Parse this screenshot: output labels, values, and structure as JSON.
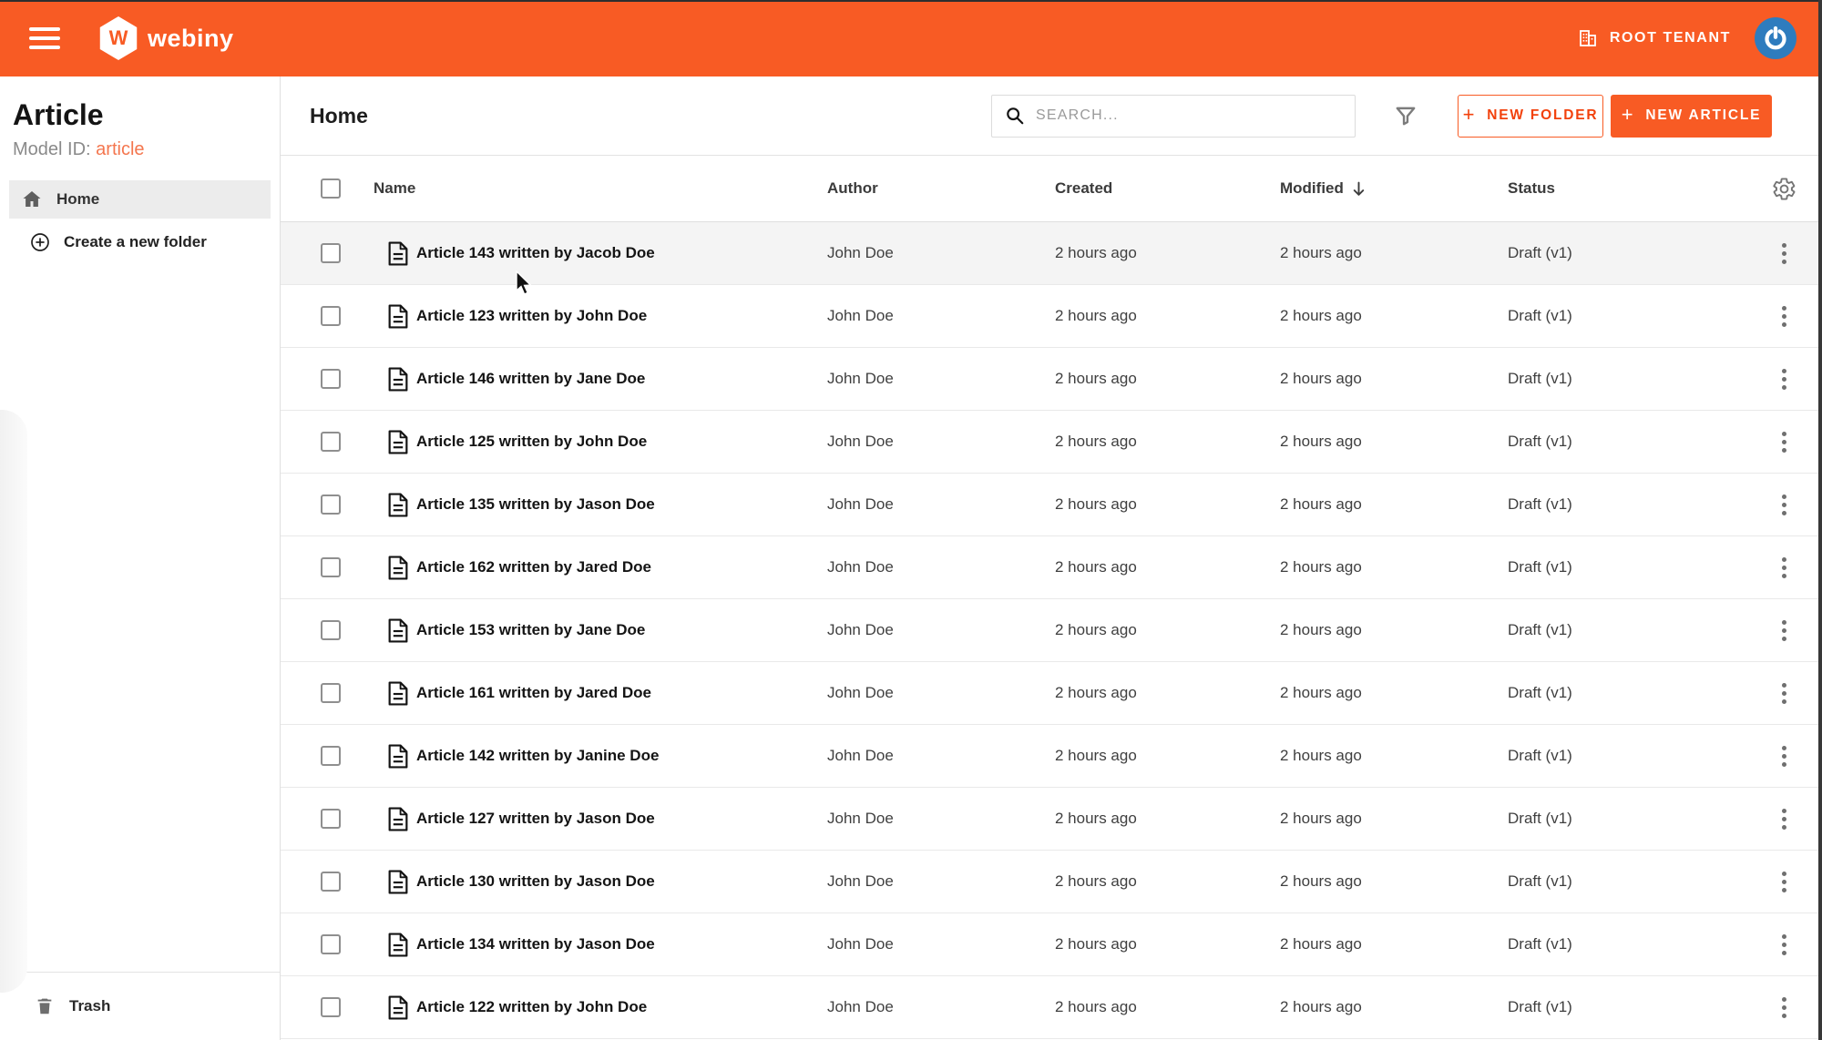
{
  "topbar": {
    "tenant_label": "ROOT TENANT"
  },
  "brand": {
    "logo_letter": "W",
    "logo_text": "webiny"
  },
  "sidebar": {
    "title": "Article",
    "model_id_label": "Model ID:",
    "model_id_value": "article",
    "home_label": "Home",
    "create_folder_label": "Create a new folder",
    "trash_label": "Trash"
  },
  "content": {
    "header": {
      "title": "Home",
      "search_placeholder": "SEARCH...",
      "plus": "+",
      "new_folder_label": "NEW FOLDER",
      "new_article_label": "NEW ARTICLE"
    },
    "table": {
      "columns": {
        "name": "Name",
        "author": "Author",
        "created": "Created",
        "modified": "Modified",
        "status": "Status"
      },
      "sorted_by": "Modified",
      "sort_direction": "desc",
      "rows": [
        {
          "name": "Article 143 written by Jacob Doe",
          "author": "John Doe",
          "created": "2 hours ago",
          "modified": "2 hours ago",
          "status": "Draft (v1)"
        },
        {
          "name": "Article 123 written by John Doe",
          "author": "John Doe",
          "created": "2 hours ago",
          "modified": "2 hours ago",
          "status": "Draft (v1)"
        },
        {
          "name": "Article 146 written by Jane Doe",
          "author": "John Doe",
          "created": "2 hours ago",
          "modified": "2 hours ago",
          "status": "Draft (v1)"
        },
        {
          "name": "Article 125 written by John Doe",
          "author": "John Doe",
          "created": "2 hours ago",
          "modified": "2 hours ago",
          "status": "Draft (v1)"
        },
        {
          "name": "Article 135 written by Jason Doe",
          "author": "John Doe",
          "created": "2 hours ago",
          "modified": "2 hours ago",
          "status": "Draft (v1)"
        },
        {
          "name": "Article 162 written by Jared Doe",
          "author": "John Doe",
          "created": "2 hours ago",
          "modified": "2 hours ago",
          "status": "Draft (v1)"
        },
        {
          "name": "Article 153 written by Jane Doe",
          "author": "John Doe",
          "created": "2 hours ago",
          "modified": "2 hours ago",
          "status": "Draft (v1)"
        },
        {
          "name": "Article 161 written by Jared Doe",
          "author": "John Doe",
          "created": "2 hours ago",
          "modified": "2 hours ago",
          "status": "Draft (v1)"
        },
        {
          "name": "Article 142 written by Janine Doe",
          "author": "John Doe",
          "created": "2 hours ago",
          "modified": "2 hours ago",
          "status": "Draft (v1)"
        },
        {
          "name": "Article 127 written by Jason Doe",
          "author": "John Doe",
          "created": "2 hours ago",
          "modified": "2 hours ago",
          "status": "Draft (v1)"
        },
        {
          "name": "Article 130 written by Jason Doe",
          "author": "John Doe",
          "created": "2 hours ago",
          "modified": "2 hours ago",
          "status": "Draft (v1)"
        },
        {
          "name": "Article 134 written by Jason Doe",
          "author": "John Doe",
          "created": "2 hours ago",
          "modified": "2 hours ago",
          "status": "Draft (v1)"
        },
        {
          "name": "Article 122 written by John Doe",
          "author": "John Doe",
          "created": "2 hours ago",
          "modified": "2 hours ago",
          "status": "Draft (v1)"
        }
      ]
    }
  },
  "colors": {
    "primary": "#f85b24",
    "primary_text_on_fill": "#ffffff",
    "model_id_link": "#f4764e",
    "avatar_bg": "#2e7cbe",
    "row_hover_bg": "#f4f4f4",
    "selected_item_bg": "#ececec"
  }
}
